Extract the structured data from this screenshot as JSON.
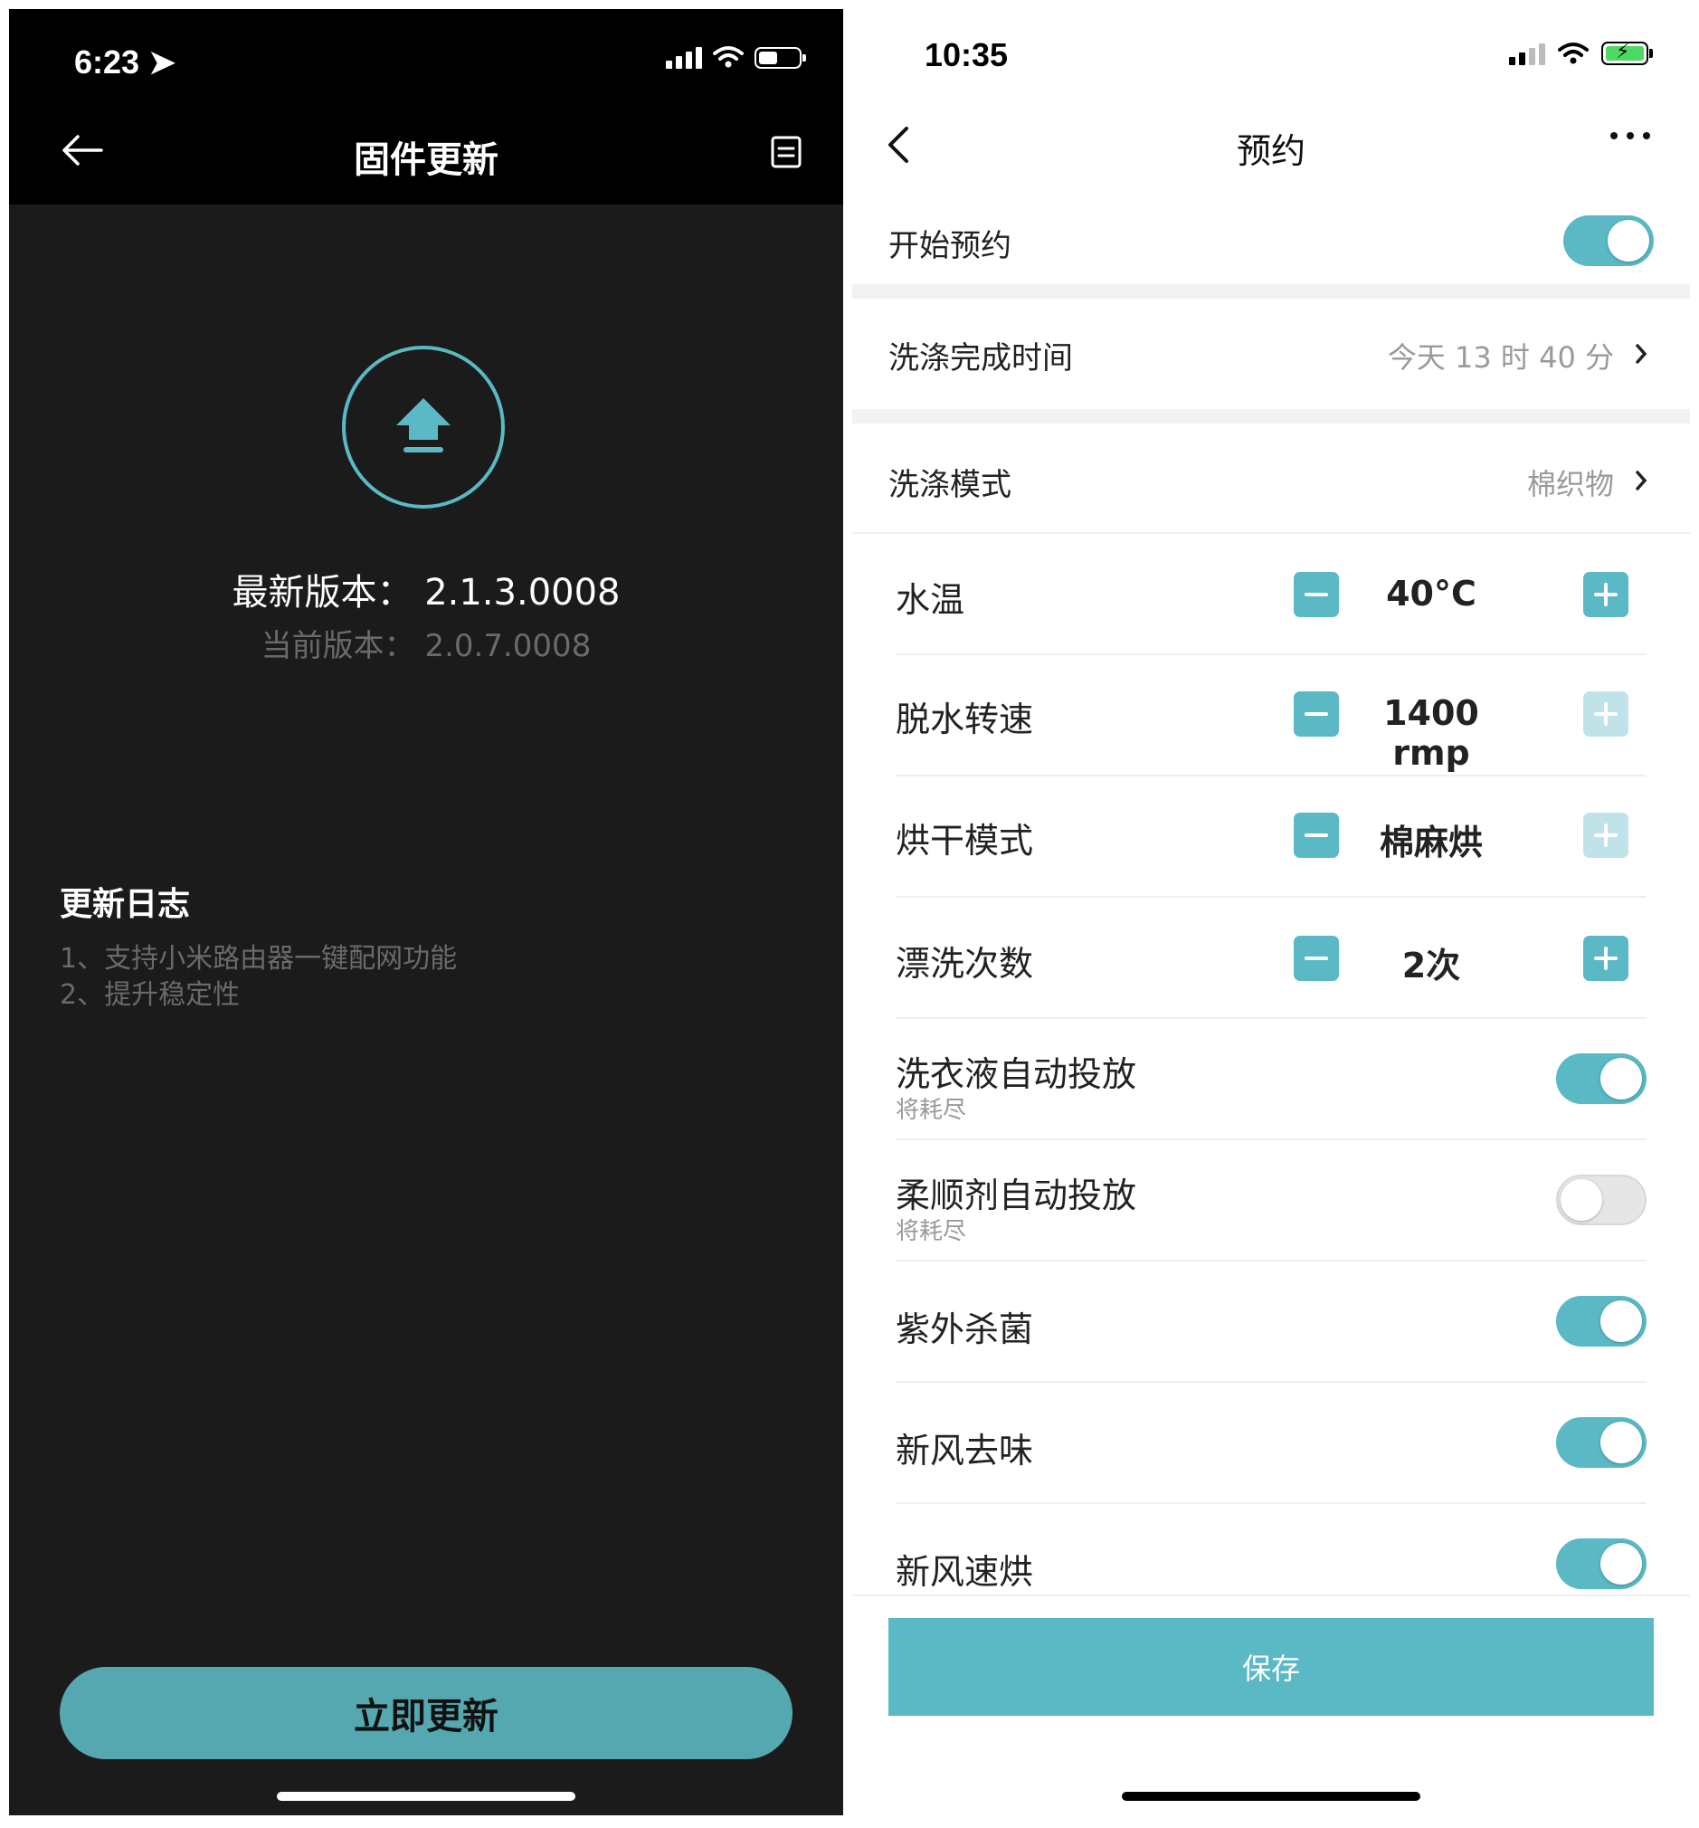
{
  "left": {
    "status": {
      "time": "6:23"
    },
    "header": {
      "title": "固件更新"
    },
    "latest_version": "最新版本：  2.1.3.0008",
    "current_version": "当前版本：  2.0.7.0008",
    "log": {
      "title": "更新日志",
      "items": [
        "1、支持小米路由器一键配网功能",
        "2、提升稳定性"
      ]
    },
    "update_button": "立即更新",
    "accent": "#5ab9c4"
  },
  "right": {
    "status": {
      "time": "10:35"
    },
    "header": {
      "title": "预约"
    },
    "start_booking": {
      "label": "开始预约",
      "on": true
    },
    "finish_time": {
      "label": "洗涤完成时间",
      "value": "今天 13 时 40 分"
    },
    "wash_mode": {
      "label": "洗涤模式",
      "value": "棉织物"
    },
    "controls": [
      {
        "label": "水温",
        "value": "40°C"
      },
      {
        "label": "脱水转速",
        "value": "1400 rmp"
      },
      {
        "label": "烘干模式",
        "value": "棉麻烘"
      },
      {
        "label": "漂洗次数",
        "value": "2次"
      }
    ],
    "toggles": [
      {
        "label": "洗衣液自动投放",
        "sub": "将耗尽",
        "on": true
      },
      {
        "label": "柔顺剂自动投放",
        "sub": "将耗尽",
        "on": false
      },
      {
        "label": "紫外杀菌",
        "on": true
      },
      {
        "label": "新风去味",
        "on": true
      },
      {
        "label": "新风速烘",
        "on": true
      }
    ],
    "save_button": "保存",
    "accent": "#5ab9c4"
  }
}
